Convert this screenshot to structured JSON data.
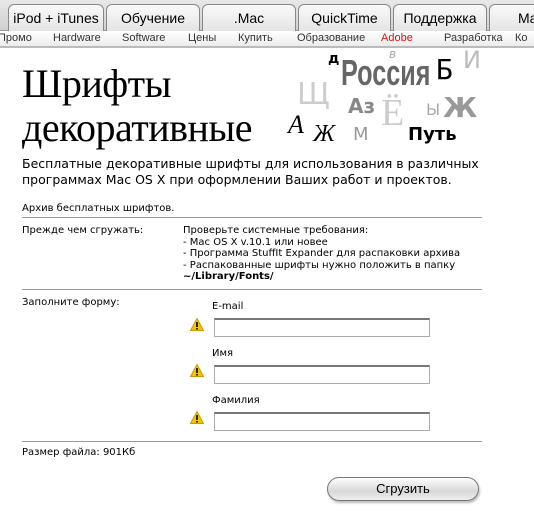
{
  "tabs": [
    {
      "label": "iPod + iTunes"
    },
    {
      "label": "Обучение"
    },
    {
      "label": ".Mac"
    },
    {
      "label": "QuickTime"
    },
    {
      "label": "Поддержка"
    },
    {
      "label": "Ma"
    }
  ],
  "subnav": [
    {
      "label": "Промо"
    },
    {
      "label": "Hardware"
    },
    {
      "label": "Software"
    },
    {
      "label": "Цены"
    },
    {
      "label": "Купить"
    },
    {
      "label": "Образование"
    },
    {
      "label": "Adobe",
      "active": true
    },
    {
      "label": "Разработка"
    },
    {
      "label": "Ко"
    }
  ],
  "page": {
    "title_line1": "Шрифты",
    "title_line2": "декоративные",
    "logo_letters": [
      "д",
      "Россия",
      "в",
      "Б",
      "И",
      "Щ",
      "Аз",
      "Ё",
      "Ж",
      "Ы",
      "А",
      "Ж",
      "М",
      "Путь"
    ],
    "description": "Бесплатные декоративные шрифты для использования в различных программах Mac OS X при оформлении Ваших работ и проектов.",
    "archive": "Архив бесплатных шрифтов.",
    "before_label": "Прежде чем сгружать:",
    "requirements": [
      "Проверьте системные требования:",
      "- Mac OS X v.10.1 или новее",
      "- Программа StuffIt Expander для распаковки архива",
      "- Распакованные шрифты нужно положить в папку",
      "~/Library/Fonts/"
    ],
    "form_label": "Заполните форму:",
    "fields": [
      {
        "label": "E-mail",
        "value": ""
      },
      {
        "label": "Имя",
        "value": ""
      },
      {
        "label": "Фамилия",
        "value": ""
      }
    ],
    "file_size": "Размер файла: 901Кб",
    "download_button": "Сгрузить"
  },
  "colors": {
    "active_nav": "#dd1111",
    "warning": "#f5c400"
  }
}
